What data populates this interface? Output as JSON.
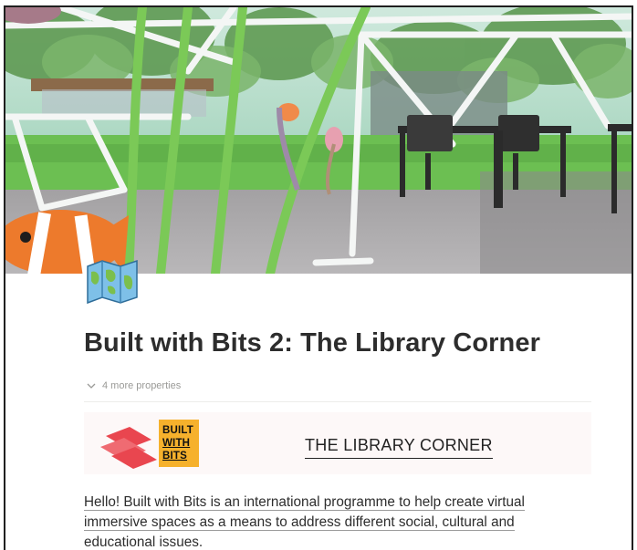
{
  "page": {
    "title": "Built with Bits 2: The Library Corner",
    "icon": "world-map-icon",
    "cover_alt_icons": [
      "clownfish",
      "sea-anemone",
      "seaweed",
      "office-desk",
      "office-chair",
      "geodesic-dome"
    ]
  },
  "properties": {
    "toggle_label": "4 more properties",
    "toggle_icon": "chevron-down-icon"
  },
  "banner": {
    "logo_lines": [
      "BUILT",
      "WITH",
      "BITS"
    ],
    "title": "THE LIBRARY CORNER"
  },
  "body": {
    "intro_text": "Hello! Built with Bits is an international programme to help create virtual immersive spaces as a means to address different social, cultural and educational issues."
  },
  "colors": {
    "title": "#2d2d2d",
    "badge": "#f6b12c",
    "logo_red": "#e9464f",
    "muted": "#9a9a97"
  }
}
